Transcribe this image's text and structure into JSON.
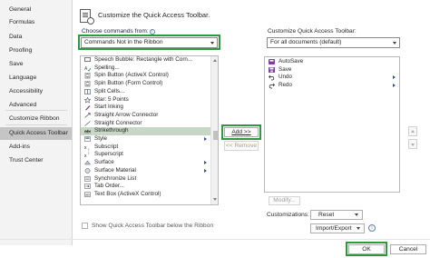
{
  "nav": {
    "items": [
      {
        "label": "General"
      },
      {
        "label": "Formulas"
      },
      {
        "label": "Data"
      },
      {
        "label": "Proofing"
      },
      {
        "label": "Save"
      },
      {
        "label": "Language"
      },
      {
        "label": "Accessibility"
      },
      {
        "label": "Advanced"
      },
      {
        "label": "Customize Ribbon"
      },
      {
        "label": "Quick Access Toolbar",
        "active": true
      },
      {
        "label": "Add-ins"
      },
      {
        "label": "Trust Center"
      }
    ]
  },
  "header": {
    "title": "Customize the Quick Access Toolbar."
  },
  "left": {
    "choose_label": "Choose commands from:",
    "choose_value": "Commands Not in the Ribbon",
    "commands": [
      {
        "label": "Speech Bubble: Rectangle with Corn...",
        "icon": "speech-bubble"
      },
      {
        "label": "Spelling...",
        "icon": "spelling"
      },
      {
        "label": "Spin Button (ActiveX Control)",
        "icon": "spin-button"
      },
      {
        "label": "Spin Button (Form Control)",
        "icon": "spin-button"
      },
      {
        "label": "Split Cells...",
        "icon": "split-cells"
      },
      {
        "label": "Star: 5 Points",
        "icon": "star"
      },
      {
        "label": "Start Inking",
        "icon": "pen"
      },
      {
        "label": "Straight Arrow Connector",
        "icon": "arrow-line"
      },
      {
        "label": "Straight Connector",
        "icon": "line"
      },
      {
        "label": "Strikethrough",
        "icon": "strikethrough",
        "selected": true
      },
      {
        "label": "Style",
        "icon": "style",
        "submenu": true
      },
      {
        "label": "Subscript",
        "icon": "subscript"
      },
      {
        "label": "Superscript",
        "icon": "superscript"
      },
      {
        "label": "Surface",
        "icon": "surface",
        "submenu": true
      },
      {
        "label": "Surface Material",
        "icon": "surface-material",
        "submenu": true
      },
      {
        "label": "Synchronize List",
        "icon": "sync-list"
      },
      {
        "label": "Tab Order...",
        "icon": "tab-order"
      },
      {
        "label": "Text Box (ActiveX Control)",
        "icon": "text-box"
      }
    ],
    "show_below_label": "Show Quick Access Toolbar below the Ribbon"
  },
  "middle": {
    "add_label": "Add >>",
    "remove_label": "<< Remove"
  },
  "right": {
    "customize_label": "Customize Quick Access Toolbar:",
    "customize_value": "For all documents (default)",
    "items": [
      {
        "label": "AutoSave",
        "icon": "autosave"
      },
      {
        "label": "Save",
        "icon": "save"
      },
      {
        "label": "Undo",
        "icon": "undo",
        "submenu": true
      },
      {
        "label": "Redo",
        "icon": "redo",
        "submenu": true
      }
    ],
    "modify_label": "Modify...",
    "customizations_label": "Customizations:",
    "reset_label": "Reset",
    "import_export_label": "Import/Export"
  },
  "footer": {
    "ok_label": "OK",
    "cancel_label": "Cancel"
  },
  "colors": {
    "highlight": "#2e9a3e",
    "selection": "#c6d7c6",
    "nav_active": "#c5c5c5",
    "icon_purple": "#7a3f9e",
    "icon_blue": "#2f5597"
  }
}
